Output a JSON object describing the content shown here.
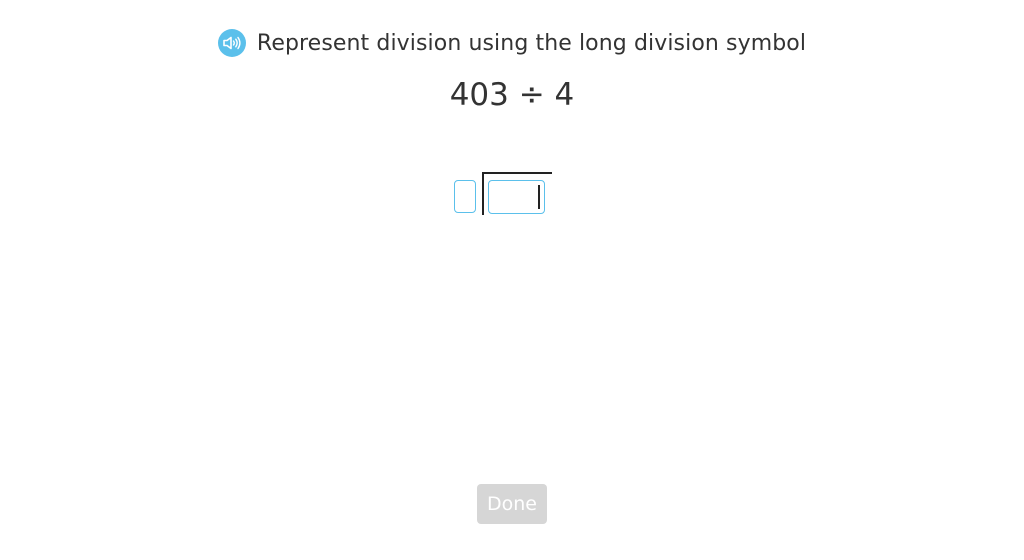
{
  "question": {
    "audio_icon": "speaker-icon",
    "text": "Represent division using the long division symbol"
  },
  "expression": "403 ÷ 4",
  "long_division": {
    "divisor_value": "",
    "dividend_value": ""
  },
  "done_button": {
    "label": "Done",
    "state": "disabled"
  },
  "colors": {
    "accent": "#5bc0eb",
    "text": "#333333",
    "button_disabled": "#d6d6d6"
  }
}
